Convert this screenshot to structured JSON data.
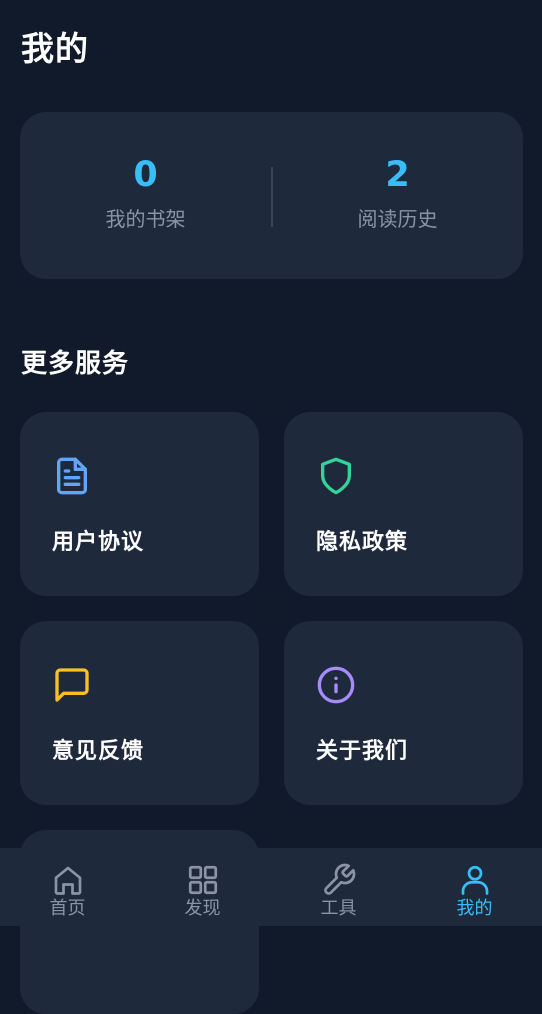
{
  "header": {
    "title": "我的"
  },
  "stats": {
    "bookshelf": {
      "value": "0",
      "label": "我的书架"
    },
    "history": {
      "value": "2",
      "label": "阅读历史"
    }
  },
  "services": {
    "title": "更多服务",
    "items": [
      {
        "label": "用户协议",
        "icon": "document-icon",
        "color": "#60a5fa"
      },
      {
        "label": "隐私政策",
        "icon": "shield-icon",
        "color": "#34d399"
      },
      {
        "label": "意见反馈",
        "icon": "message-icon",
        "color": "#fbbf24"
      },
      {
        "label": "关于我们",
        "icon": "info-icon",
        "color": "#a78bfa"
      }
    ]
  },
  "tabbar": {
    "items": [
      {
        "label": "首页",
        "icon": "home-icon"
      },
      {
        "label": "发现",
        "icon": "grid-icon"
      },
      {
        "label": "工具",
        "icon": "wrench-icon"
      },
      {
        "label": "我的",
        "icon": "user-icon",
        "active": true
      }
    ]
  },
  "colors": {
    "background": "#111a2b",
    "card": "#1e293b",
    "accent": "#38bdf8",
    "muted_text": "#8a94a6"
  }
}
